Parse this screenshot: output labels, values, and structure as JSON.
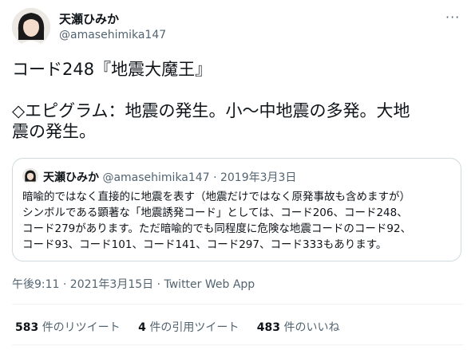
{
  "author": {
    "name": "天瀬ひみか",
    "handle": "@amasehimika147"
  },
  "more_icon": "ellipsis-icon",
  "tweet": {
    "text": "コード248『地震大魔王』\n\n◇エピグラム：地震の発生。小〜中地震の多発。大地\n震の発生。"
  },
  "quoted": {
    "name": "天瀬ひみか",
    "handle": "@amasehimika147",
    "separator": "·",
    "date": "2019年3月3日",
    "text": "暗喩的ではなく直接的に地震を表す（地震だけではなく原発事故も含めますが）\nシンボルである顕著な「地震誘発コード」としては、コード206、コード248、\nコード279があります。ただ暗喩的でも同程度に危険な地震コードのコード92、\nコード93、コード101、コード141、コード297、コード333もあります。"
  },
  "timestamp": "午後9:11 · 2021年3月15日 · Twitter Web App",
  "stats": {
    "retweets_count": "583",
    "retweets_label": "件のリツイート",
    "quotes_count": "4",
    "quotes_label": "件の引用ツイート",
    "likes_count": "483",
    "likes_label": "件のいいね"
  }
}
